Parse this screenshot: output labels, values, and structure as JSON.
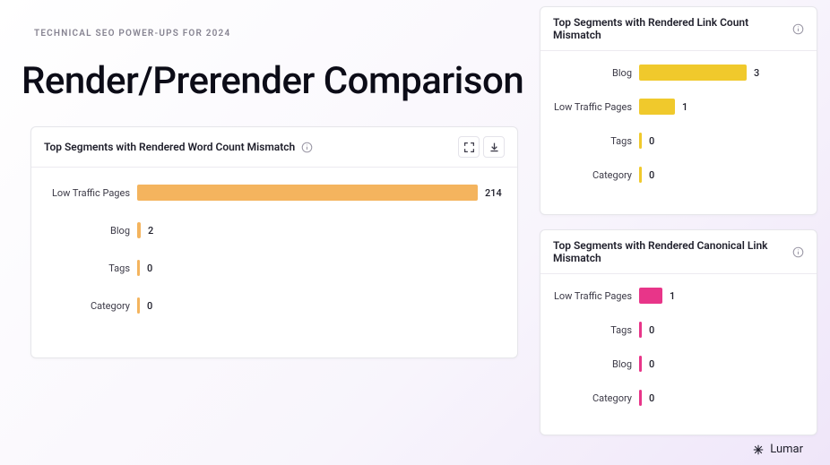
{
  "eyebrow": "TECHNICAL SEO POWER-UPS FOR 2024",
  "title": "Render/Prerender Comparison",
  "brand": "Lumar",
  "colors": {
    "orange": "#f4b45e",
    "yellow": "#f0c92c",
    "magenta": "#e83589"
  },
  "panels": {
    "word_count": {
      "title": "Top Segments with Rendered Word Count Mismatch",
      "rows": [
        {
          "label": "Low Traffic Pages",
          "value": 214
        },
        {
          "label": "Blog",
          "value": 2
        },
        {
          "label": "Tags",
          "value": 0
        },
        {
          "label": "Category",
          "value": 0
        }
      ]
    },
    "link_count": {
      "title": "Top Segments with Rendered Link Count Mismatch",
      "rows": [
        {
          "label": "Blog",
          "value": 3
        },
        {
          "label": "Low Traffic Pages",
          "value": 1
        },
        {
          "label": "Tags",
          "value": 0
        },
        {
          "label": "Category",
          "value": 0
        }
      ]
    },
    "canonical": {
      "title": "Top Segments with Rendered Canonical Link Mismatch",
      "rows": [
        {
          "label": "Low Traffic Pages",
          "value": 1
        },
        {
          "label": "Tags",
          "value": 0
        },
        {
          "label": "Blog",
          "value": 0
        },
        {
          "label": "Category",
          "value": 0
        }
      ]
    }
  },
  "chart_data": [
    {
      "type": "bar",
      "title": "Top Segments with Rendered Word Count Mismatch",
      "categories": [
        "Low Traffic Pages",
        "Blog",
        "Tags",
        "Category"
      ],
      "values": [
        214,
        2,
        0,
        0
      ],
      "xlabel": "",
      "ylabel": "",
      "color": "#f4b45e",
      "orientation": "horizontal"
    },
    {
      "type": "bar",
      "title": "Top Segments with Rendered Link Count Mismatch",
      "categories": [
        "Blog",
        "Low Traffic Pages",
        "Tags",
        "Category"
      ],
      "values": [
        3,
        1,
        0,
        0
      ],
      "xlabel": "",
      "ylabel": "",
      "color": "#f0c92c",
      "orientation": "horizontal"
    },
    {
      "type": "bar",
      "title": "Top Segments with Rendered Canonical Link Mismatch",
      "categories": [
        "Low Traffic Pages",
        "Tags",
        "Blog",
        "Category"
      ],
      "values": [
        1,
        0,
        0,
        0
      ],
      "xlabel": "",
      "ylabel": "",
      "color": "#e83589",
      "orientation": "horizontal"
    }
  ]
}
